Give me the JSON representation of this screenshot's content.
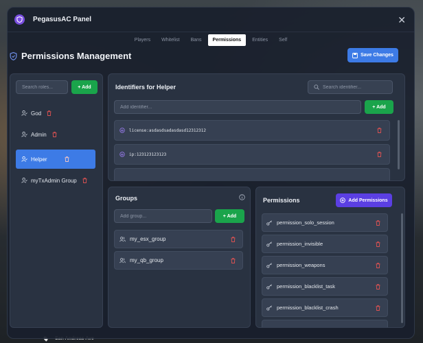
{
  "window": {
    "title": "PegasusAC Panel"
  },
  "tabs": [
    {
      "label": "Players"
    },
    {
      "label": "Whitelist"
    },
    {
      "label": "Bans"
    },
    {
      "label": "Permissions"
    },
    {
      "label": "Entities"
    },
    {
      "label": "Self"
    }
  ],
  "page": {
    "title": "Permissions Management",
    "save_label": "Save Changes"
  },
  "roles": {
    "search_placeholder": "Search roles...",
    "add_label": "+ Add",
    "items": [
      {
        "label": "God"
      },
      {
        "label": "Admin"
      },
      {
        "label": "Helper"
      },
      {
        "label": "myTxAdmin Group"
      }
    ],
    "selected": "Helper"
  },
  "identifiers": {
    "title": "Identifiers for Helper",
    "search_placeholder": "Search identifier...",
    "add_placeholder": "Add identifier...",
    "add_label": "+ Add",
    "items": [
      {
        "value": "license:asdasdsadasdasd12312312"
      },
      {
        "value": "ip:123123123123"
      }
    ]
  },
  "groups": {
    "title": "Groups",
    "add_placeholder": "Add group...",
    "add_label": "+ Add",
    "items": [
      {
        "label": "my_esx_group"
      },
      {
        "label": "my_qb_group"
      }
    ]
  },
  "permissions": {
    "title": "Permissions",
    "add_label": "Add Permissions",
    "items": [
      {
        "label": "permission_solo_session"
      },
      {
        "label": "permission_invisible"
      },
      {
        "label": "permission_weapons"
      },
      {
        "label": "permission_blacklist_task"
      },
      {
        "label": "permission_blacklist_crash"
      }
    ]
  },
  "background": {
    "street_label": "San Andreas Ave"
  },
  "colors": {
    "accent_blue": "#3d7be6",
    "accent_green": "#1aa44b",
    "accent_purple": "#5b3fe3",
    "delete_red": "#e05252"
  },
  "icons": {
    "logo": "shield-icon",
    "role": "user-icon",
    "identifier": "fingerprint-icon",
    "group": "users-icon",
    "permission": "key-icon",
    "delete": "trash-icon"
  }
}
